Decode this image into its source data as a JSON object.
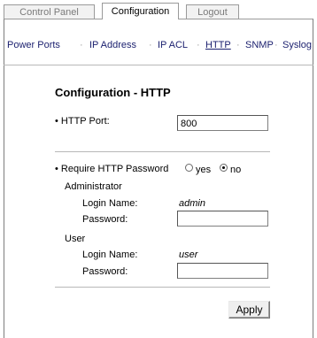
{
  "tabs": [
    {
      "label": "Control Panel",
      "active": false
    },
    {
      "label": "Configuration",
      "active": true
    },
    {
      "label": "Logout",
      "active": false
    }
  ],
  "nav": {
    "items": [
      "Power Ports",
      "IP Address",
      "IP ACL",
      "HTTP",
      "SNMP",
      "Syslog"
    ],
    "separator": "·",
    "active": "HTTP"
  },
  "section_title": "Configuration - HTTP",
  "http_port": {
    "label": "• HTTP Port:",
    "value": "800"
  },
  "require_password": {
    "label": "• Require HTTP Password",
    "options": [
      "yes",
      "no"
    ],
    "selected": "no"
  },
  "administrator": {
    "heading": "Administrator",
    "login_label": "Login Name:",
    "login_value": "admin",
    "password_label": "Password:",
    "password_value": ""
  },
  "user": {
    "heading": "User",
    "login_label": "Login Name:",
    "login_value": "user",
    "password_label": "Password:",
    "password_value": ""
  },
  "apply_button": "Apply"
}
